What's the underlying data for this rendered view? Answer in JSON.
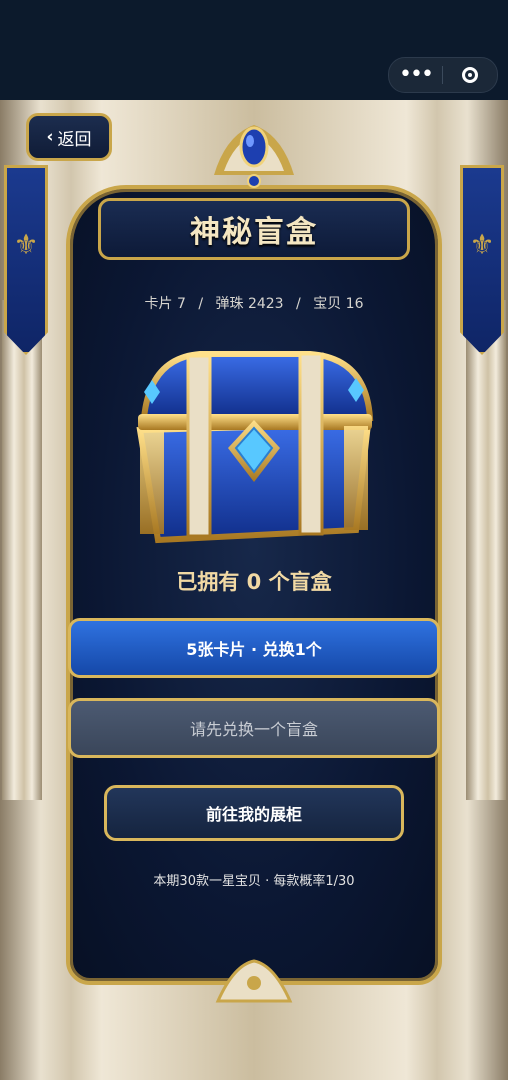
{
  "topbar": {
    "more_icon": "more-dots-icon",
    "target_icon": "target-icon"
  },
  "nav": {
    "back_label": "返回"
  },
  "header": {
    "title": "神秘盲盒"
  },
  "stats": {
    "cards": "卡片 7",
    "marbles": "弹珠 2423",
    "treasure": "宝贝 16",
    "separator": "/"
  },
  "chest": {
    "icon": "treasure-chest-icon"
  },
  "owned": {
    "text": "已拥有 0 个盲盒"
  },
  "actions": {
    "exchange_label": "5张卡片 · 兑换1个",
    "open_label": "请先兑换一个盲盒",
    "cabinet_label": "前往我的展柜"
  },
  "footnote": {
    "text": "本期30款一星宝贝 · 每款概率1/30"
  },
  "colors": {
    "gold": "#c9a64a",
    "primary_blue": "#2f72e0",
    "panel_navy": "#0b1733"
  }
}
